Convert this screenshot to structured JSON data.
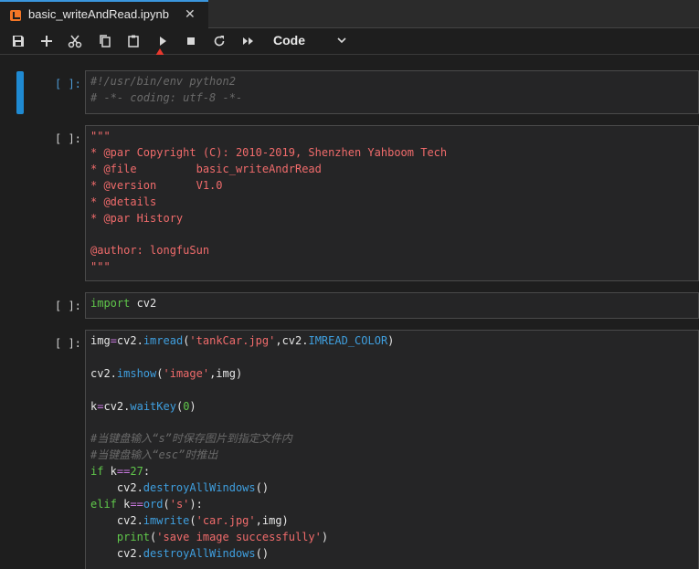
{
  "tab": {
    "title": "basic_writeAndRead.ipynb",
    "close": "✕"
  },
  "toolbar": {
    "buttons": [
      "save-icon",
      "add-cell-icon",
      "cut-icon",
      "copy-icon",
      "paste-icon",
      "run-icon",
      "stop-icon",
      "restart-icon",
      "run-all-icon"
    ],
    "cell_type": "Code"
  },
  "cells": [
    {
      "prompt": "[ ]:",
      "lines": [
        "#!/usr/bin/env python2",
        "# -*- coding: utf-8 -*-"
      ]
    },
    {
      "prompt": "[ ]:",
      "lines": [
        "\"\"\"",
        "* @par Copyright (C): 2010-2019, Shenzhen Yahboom Tech",
        "* @file         basic_writeAndrRead",
        "* @version      V1.0",
        "* @details",
        "* @par History",
        "",
        "@author: longfuSun",
        "\"\"\""
      ]
    },
    {
      "prompt": "[ ]:",
      "lines": [
        "import cv2"
      ]
    },
    {
      "prompt": "[ ]:",
      "lines": [
        "img=cv2.imread('tankCar.jpg',cv2.IMREAD_COLOR)",
        "",
        "cv2.imshow('image',img)",
        "",
        "k=cv2.waitKey(0)",
        "",
        "#当键盘输入“s”时保存图片到指定文件内",
        "#当键盘输入“esc”时推出",
        "if k==27:",
        "    cv2.destroyAllWindows()",
        "elif k==ord('s'):",
        "    cv2.imwrite('car.jpg',img)",
        "    print('save image successfully')",
        "    cv2.destroyAllWindows()"
      ]
    }
  ],
  "colors": {
    "accent": "#1f8ad2",
    "string": "#f06b6b",
    "keyword": "#60c84b",
    "function": "#3f9fdf",
    "arrow": "#e8392e"
  }
}
